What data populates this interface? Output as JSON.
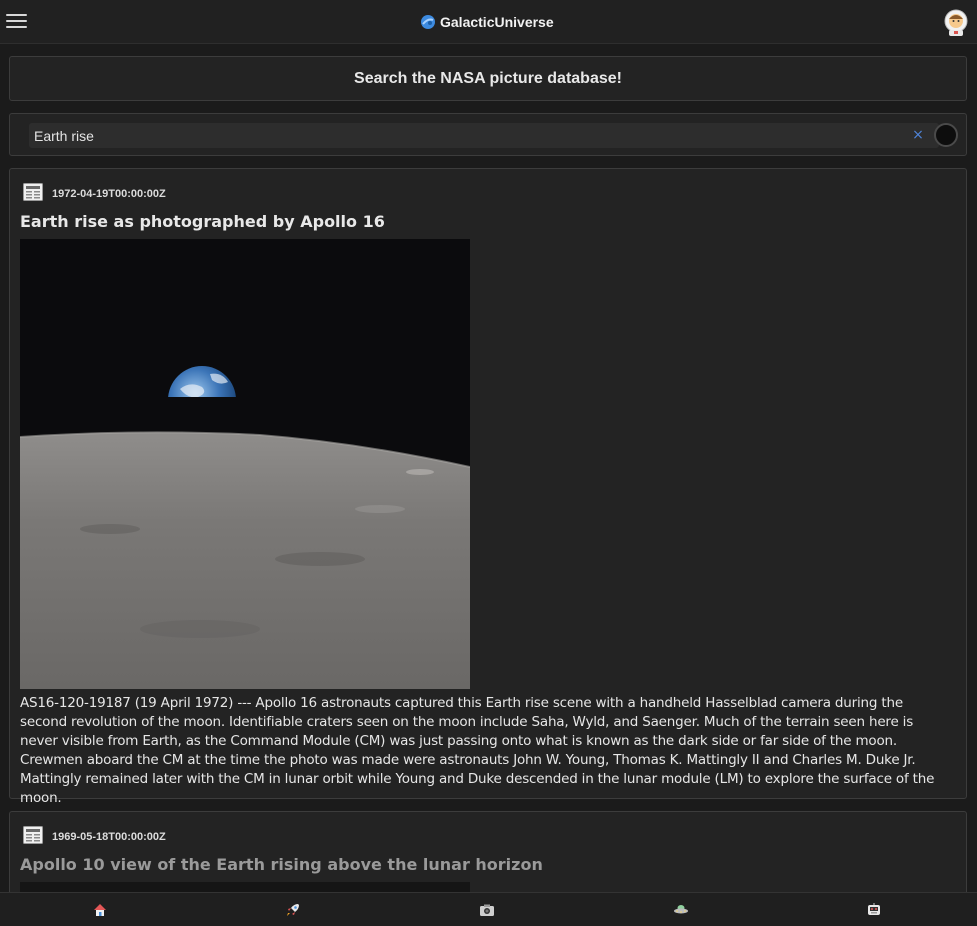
{
  "app": {
    "brand_name": "GalacticUniverse",
    "accent_color": "#3d8be0"
  },
  "header": {
    "menu_icon": "hamburger-menu-icon",
    "logo_icon": "planet-logo-icon",
    "avatar_icon": "astronaut-avatar-icon"
  },
  "search": {
    "heading": "Search the NASA picture database!",
    "value": "Earth rise",
    "clear_label": "×",
    "submit_icon": "search-go-circle-icon"
  },
  "results": [
    {
      "date": "1972-04-19T00:00:00Z",
      "title": "Earth rise as photographed by Apollo 16",
      "image": "earth-rising-over-lunar-horizon",
      "description": "AS16-120-19187 (19 April 1972) --- Apollo 16 astronauts captured this Earth rise scene with a handheld Hasselblad camera during the second revolution of the moon. Identifiable craters seen on the moon include Saha, Wyld, and Saenger. Much of the terrain seen here is never visible from Earth, as the Command Module (CM) was just passing onto what is known as the dark side or far side of the moon. Crewmen aboard the CM at the time the photo was made were astronauts John W. Young, Thomas K. Mattingly II and Charles M. Duke Jr. Mattingly remained later with the CM in lunar orbit while Young and Duke descended in the lunar module (LM) to explore the surface of the moon."
    },
    {
      "date": "1969-05-18T00:00:00Z",
      "title": "Apollo 10 view of the Earth rising above the lunar horizon"
    }
  ],
  "bottom_nav": [
    {
      "icon": "home-icon"
    },
    {
      "icon": "rocket-icon"
    },
    {
      "icon": "camera-icon"
    },
    {
      "icon": "ufo-icon"
    },
    {
      "icon": "robot-icon"
    }
  ]
}
